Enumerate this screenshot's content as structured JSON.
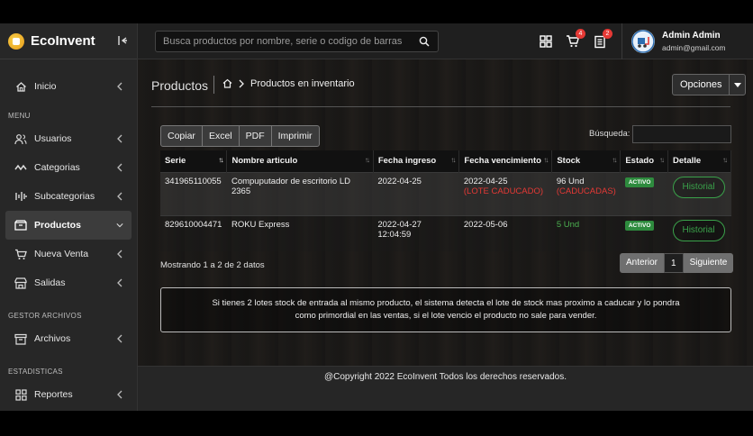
{
  "brand": {
    "name": "EcoInvent"
  },
  "sidebar": {
    "items_top": [
      {
        "label": "Inicio",
        "icon": "home-icon"
      }
    ],
    "section_menu": "MENU",
    "items_menu": [
      {
        "label": "Usuarios",
        "icon": "users-icon"
      },
      {
        "label": "Categorias",
        "icon": "categories-icon"
      },
      {
        "label": "Subcategorias",
        "icon": "subcategories-icon"
      },
      {
        "label": "Productos",
        "icon": "box-icon",
        "active": true
      },
      {
        "label": "Nueva Venta",
        "icon": "cart-icon"
      },
      {
        "label": "Salidas",
        "icon": "store-icon"
      }
    ],
    "section_files": "GESTOR ARCHIVOS",
    "items_files": [
      {
        "label": "Archivos",
        "icon": "archive-icon"
      }
    ],
    "section_stats": "ESTADISTICAS",
    "items_stats": [
      {
        "label": "Reportes",
        "icon": "grid-icon"
      }
    ]
  },
  "header": {
    "search_placeholder": "Busca productos por nombre, serie o codigo de barras",
    "cart_badge": "4",
    "orders_badge": "2",
    "user_name": "Admin Admin",
    "user_email": "admin@gmail.com"
  },
  "page": {
    "title": "Productos",
    "breadcrumb_current": "Productos en inventario",
    "options_label": "Opciones"
  },
  "toolbar": {
    "buttons": [
      "Copiar",
      "Excel",
      "PDF",
      "Imprimir"
    ],
    "search_label": "Búsqueda:"
  },
  "table": {
    "columns": [
      "Serie",
      "Nombre articulo",
      "Fecha ingreso",
      "Fecha vencimiento",
      "Stock",
      "Estado",
      "Detalle"
    ],
    "rows": [
      {
        "serie": "341965110055",
        "nombre": "Compuputador de escritorio LD 2365",
        "ingreso": "2022-04-25",
        "vencimiento": "2022-04-25",
        "vencimiento_note": "(LOTE CADUCADO)",
        "stock": "96 Und",
        "stock_note": "(CADUCADAS)",
        "estado": "ACTIVO",
        "detalle": "Historial"
      },
      {
        "serie": "829610004471",
        "nombre": "ROKU Express",
        "ingreso": "2022-04-27 12:04:59",
        "vencimiento": "2022-05-06",
        "vencimiento_note": "",
        "stock": "5 Und",
        "stock_note": "",
        "estado": "ACTIVO",
        "detalle": "Historial"
      }
    ]
  },
  "pagination": {
    "showing": "Mostrando 1 a 2 de 2 datos",
    "prev": "Anterior",
    "current": "1",
    "next": "Siguiente"
  },
  "note": {
    "line1": "Si tienes 2 lotes stock de entrada al mismo producto, el sistema detecta el lote de stock mas proximo a caducar y lo pondra",
    "line2": "como primordial en las ventas, si el lote vencio el producto no sale para vender."
  },
  "footer": {
    "text": "@Copyright 2022 EcoInvent Todos los derechos reservados."
  },
  "colors": {
    "accent_green": "#2e8b3e",
    "danger": "#e53935",
    "badge": "#e53935"
  }
}
